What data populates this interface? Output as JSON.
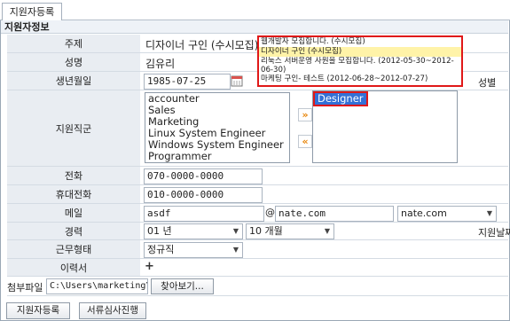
{
  "tab": {
    "label": "지원자등록"
  },
  "section": {
    "title": "지원자정보"
  },
  "fields": {
    "subject": {
      "label": "주제",
      "value": "디자이너 구인 (수시모집)"
    },
    "name": {
      "label": "성명",
      "value": "김유리"
    },
    "birth": {
      "label": "생년월일",
      "value": "1985-07-25"
    },
    "gender": {
      "label": "성별"
    },
    "job": {
      "label": "지원직군"
    },
    "phone": {
      "label": "전화",
      "value": "070-0000-0000"
    },
    "mobile": {
      "label": "휴대전화",
      "value": "010-0000-0000"
    },
    "email": {
      "label": "메일",
      "user": "asdf",
      "at": "@",
      "domain": "nate.com",
      "domain_select": "nate.com"
    },
    "career": {
      "label": "경력",
      "years": "01 년",
      "months": "10 개월",
      "path_label": "지원날짜"
    },
    "worktype": {
      "label": "근무형태",
      "value": "정규직"
    },
    "resume": {
      "label": "이력서",
      "add": "+"
    },
    "attach": {
      "label": "첨부파일",
      "path": "C:\\Users\\marketing\\De",
      "browse": "찾아보기..."
    }
  },
  "subject_options": [
    "웹개발자 모집합니다. (수시모집)",
    "디자이너 구인 (수시모집)",
    "리눅스 서버운영 사원을 모집합니다. (2012-05-30~2012-06-30)",
    "마케팅 구인- 테스트 (2012-06-28~2012-07-27)"
  ],
  "job_available": [
    "accounter",
    "Sales",
    "Marketing",
    "Linux System Engineer",
    "Windows System Engineer",
    "Programmer"
  ],
  "job_selected": [
    "Designer"
  ],
  "move_buttons": {
    "add": "»",
    "remove": "«"
  },
  "buttons": {
    "register": "지원자등록",
    "review": "서류심사진행"
  },
  "colors": {
    "highlight_border": "#e01818",
    "selected_item": "#3370d6",
    "dropdown_highlight": "#fff3a8"
  }
}
